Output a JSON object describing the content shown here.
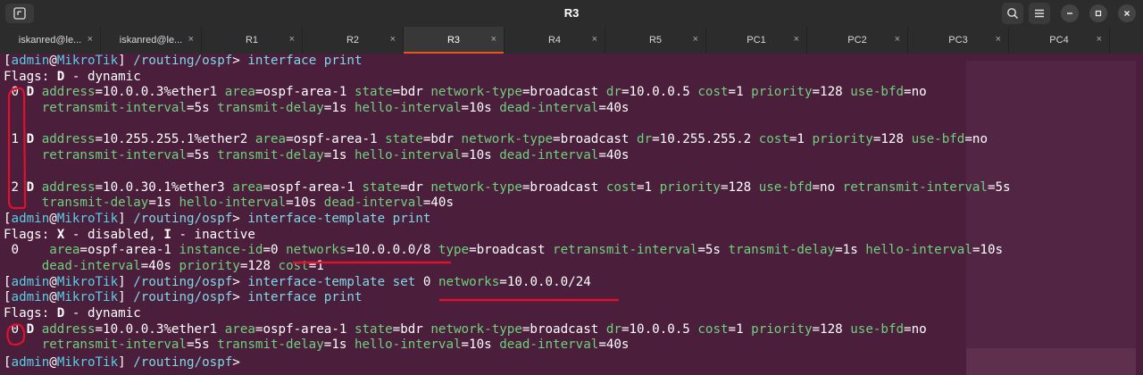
{
  "window": {
    "title": "R3",
    "tabs": [
      {
        "label": "iskanred@le...",
        "active": false
      },
      {
        "label": "iskanred@le...",
        "active": false
      },
      {
        "label": "R1",
        "active": false
      },
      {
        "label": "R2",
        "active": false
      },
      {
        "label": "R3",
        "active": true
      },
      {
        "label": "R4",
        "active": false
      },
      {
        "label": "R5",
        "active": false
      },
      {
        "label": "PC1",
        "active": false
      },
      {
        "label": "PC2",
        "active": false
      },
      {
        "label": "PC3",
        "active": false
      },
      {
        "label": "PC4",
        "active": false
      }
    ],
    "close_glyph": "×"
  },
  "terminal": {
    "prompt_user": "admin",
    "prompt_host": "MikroTik",
    "prompt_path": "/routing/ospf",
    "lines": [
      [
        {
          "c": "w",
          "t": "["
        },
        {
          "c": "pr",
          "t": "admin"
        },
        {
          "c": "w",
          "t": "@"
        },
        {
          "c": "pr",
          "t": "MikroTik"
        },
        {
          "c": "w",
          "t": "] "
        },
        {
          "c": "cmd",
          "t": "/routing/ospf"
        },
        {
          "c": "w",
          "t": "> "
        },
        {
          "c": "cmd",
          "t": "interface print"
        }
      ],
      [
        {
          "c": "w",
          "t": "Flags: "
        },
        {
          "c": "b",
          "t": "D"
        },
        {
          "c": "w",
          "t": " - dynamic"
        }
      ],
      [
        {
          "c": "w",
          "t": " 0 "
        },
        {
          "c": "b",
          "t": "D"
        },
        {
          "c": "w",
          "t": " "
        },
        {
          "c": "key",
          "t": "address"
        },
        {
          "c": "w",
          "t": "=10.0.0.3%ether1 "
        },
        {
          "c": "key",
          "t": "area"
        },
        {
          "c": "w",
          "t": "=ospf-area-1 "
        },
        {
          "c": "key",
          "t": "state"
        },
        {
          "c": "w",
          "t": "=bdr "
        },
        {
          "c": "key",
          "t": "network-type"
        },
        {
          "c": "w",
          "t": "=broadcast "
        },
        {
          "c": "key",
          "t": "dr"
        },
        {
          "c": "w",
          "t": "=10.0.0.5 "
        },
        {
          "c": "key",
          "t": "cost"
        },
        {
          "c": "w",
          "t": "=1 "
        },
        {
          "c": "key",
          "t": "priority"
        },
        {
          "c": "w",
          "t": "=128 "
        },
        {
          "c": "key",
          "t": "use-bfd"
        },
        {
          "c": "w",
          "t": "=no"
        }
      ],
      [
        {
          "c": "w",
          "t": "     "
        },
        {
          "c": "key",
          "t": "retransmit-interval"
        },
        {
          "c": "w",
          "t": "=5s "
        },
        {
          "c": "key",
          "t": "transmit-delay"
        },
        {
          "c": "w",
          "t": "=1s "
        },
        {
          "c": "key",
          "t": "hello-interval"
        },
        {
          "c": "w",
          "t": "=10s "
        },
        {
          "c": "key",
          "t": "dead-interval"
        },
        {
          "c": "w",
          "t": "=40s"
        }
      ],
      [],
      [
        {
          "c": "w",
          "t": " 1 "
        },
        {
          "c": "b",
          "t": "D"
        },
        {
          "c": "w",
          "t": " "
        },
        {
          "c": "key",
          "t": "address"
        },
        {
          "c": "w",
          "t": "=10.255.255.1%ether2 "
        },
        {
          "c": "key",
          "t": "area"
        },
        {
          "c": "w",
          "t": "=ospf-area-1 "
        },
        {
          "c": "key",
          "t": "state"
        },
        {
          "c": "w",
          "t": "=bdr "
        },
        {
          "c": "key",
          "t": "network-type"
        },
        {
          "c": "w",
          "t": "=broadcast "
        },
        {
          "c": "key",
          "t": "dr"
        },
        {
          "c": "w",
          "t": "=10.255.255.2 "
        },
        {
          "c": "key",
          "t": "cost"
        },
        {
          "c": "w",
          "t": "=1 "
        },
        {
          "c": "key",
          "t": "priority"
        },
        {
          "c": "w",
          "t": "=128 "
        },
        {
          "c": "key",
          "t": "use-bfd"
        },
        {
          "c": "w",
          "t": "=no"
        }
      ],
      [
        {
          "c": "w",
          "t": "     "
        },
        {
          "c": "key",
          "t": "retransmit-interval"
        },
        {
          "c": "w",
          "t": "=5s "
        },
        {
          "c": "key",
          "t": "transmit-delay"
        },
        {
          "c": "w",
          "t": "=1s "
        },
        {
          "c": "key",
          "t": "hello-interval"
        },
        {
          "c": "w",
          "t": "=10s "
        },
        {
          "c": "key",
          "t": "dead-interval"
        },
        {
          "c": "w",
          "t": "=40s"
        }
      ],
      [],
      [
        {
          "c": "w",
          "t": " 2 "
        },
        {
          "c": "b",
          "t": "D"
        },
        {
          "c": "w",
          "t": " "
        },
        {
          "c": "key",
          "t": "address"
        },
        {
          "c": "w",
          "t": "=10.0.30.1%ether3 "
        },
        {
          "c": "key",
          "t": "area"
        },
        {
          "c": "w",
          "t": "=ospf-area-1 "
        },
        {
          "c": "key",
          "t": "state"
        },
        {
          "c": "w",
          "t": "=dr "
        },
        {
          "c": "key",
          "t": "network-type"
        },
        {
          "c": "w",
          "t": "=broadcast "
        },
        {
          "c": "key",
          "t": "cost"
        },
        {
          "c": "w",
          "t": "=1 "
        },
        {
          "c": "key",
          "t": "priority"
        },
        {
          "c": "w",
          "t": "=128 "
        },
        {
          "c": "key",
          "t": "use-bfd"
        },
        {
          "c": "w",
          "t": "=no "
        },
        {
          "c": "key",
          "t": "retransmit-interval"
        },
        {
          "c": "w",
          "t": "=5s"
        }
      ],
      [
        {
          "c": "w",
          "t": "     "
        },
        {
          "c": "key",
          "t": "transmit-delay"
        },
        {
          "c": "w",
          "t": "=1s "
        },
        {
          "c": "key",
          "t": "hello-interval"
        },
        {
          "c": "w",
          "t": "=10s "
        },
        {
          "c": "key",
          "t": "dead-interval"
        },
        {
          "c": "w",
          "t": "=40s"
        }
      ],
      [
        {
          "c": "w",
          "t": "["
        },
        {
          "c": "pr",
          "t": "admin"
        },
        {
          "c": "w",
          "t": "@"
        },
        {
          "c": "pr",
          "t": "MikroTik"
        },
        {
          "c": "w",
          "t": "] "
        },
        {
          "c": "cmd",
          "t": "/routing/ospf"
        },
        {
          "c": "w",
          "t": "> "
        },
        {
          "c": "cmd",
          "t": "interface-template print"
        }
      ],
      [
        {
          "c": "w",
          "t": "Flags: "
        },
        {
          "c": "b",
          "t": "X"
        },
        {
          "c": "w",
          "t": " - disabled, "
        },
        {
          "c": "b",
          "t": "I"
        },
        {
          "c": "w",
          "t": " - inactive"
        }
      ],
      [
        {
          "c": "w",
          "t": " 0    "
        },
        {
          "c": "key",
          "t": "area"
        },
        {
          "c": "w",
          "t": "=ospf-area-1 "
        },
        {
          "c": "key",
          "t": "instance-id"
        },
        {
          "c": "w",
          "t": "=0 "
        },
        {
          "c": "key",
          "t": "networks"
        },
        {
          "c": "w",
          "t": "=10.0.0.0/8 "
        },
        {
          "c": "key",
          "t": "type"
        },
        {
          "c": "w",
          "t": "=broadcast "
        },
        {
          "c": "key",
          "t": "retransmit-interval"
        },
        {
          "c": "w",
          "t": "=5s "
        },
        {
          "c": "key",
          "t": "transmit-delay"
        },
        {
          "c": "w",
          "t": "=1s "
        },
        {
          "c": "key",
          "t": "hello-interval"
        },
        {
          "c": "w",
          "t": "=10s"
        }
      ],
      [
        {
          "c": "w",
          "t": "     "
        },
        {
          "c": "key",
          "t": "dead-interval"
        },
        {
          "c": "w",
          "t": "=40s "
        },
        {
          "c": "key",
          "t": "priority"
        },
        {
          "c": "w",
          "t": "=128 "
        },
        {
          "c": "key",
          "t": "cost"
        },
        {
          "c": "w",
          "t": "=1"
        }
      ],
      [
        {
          "c": "w",
          "t": "["
        },
        {
          "c": "pr",
          "t": "admin"
        },
        {
          "c": "w",
          "t": "@"
        },
        {
          "c": "pr",
          "t": "MikroTik"
        },
        {
          "c": "w",
          "t": "] "
        },
        {
          "c": "cmd",
          "t": "/routing/ospf"
        },
        {
          "c": "w",
          "t": "> "
        },
        {
          "c": "cmd",
          "t": "interface-template set"
        },
        {
          "c": "w",
          "t": " 0 "
        },
        {
          "c": "key",
          "t": "networks"
        },
        {
          "c": "w",
          "t": "=10.0.0.0/24"
        }
      ],
      [
        {
          "c": "w",
          "t": "["
        },
        {
          "c": "pr",
          "t": "admin"
        },
        {
          "c": "w",
          "t": "@"
        },
        {
          "c": "pr",
          "t": "MikroTik"
        },
        {
          "c": "w",
          "t": "] "
        },
        {
          "c": "cmd",
          "t": "/routing/ospf"
        },
        {
          "c": "w",
          "t": "> "
        },
        {
          "c": "cmd",
          "t": "interface print"
        }
      ],
      [
        {
          "c": "w",
          "t": "Flags: "
        },
        {
          "c": "b",
          "t": "D"
        },
        {
          "c": "w",
          "t": " - dynamic"
        }
      ],
      [
        {
          "c": "w",
          "t": " 0 "
        },
        {
          "c": "b",
          "t": "D"
        },
        {
          "c": "w",
          "t": " "
        },
        {
          "c": "key",
          "t": "address"
        },
        {
          "c": "w",
          "t": "=10.0.0.3%ether1 "
        },
        {
          "c": "key",
          "t": "area"
        },
        {
          "c": "w",
          "t": "=ospf-area-1 "
        },
        {
          "c": "key",
          "t": "state"
        },
        {
          "c": "w",
          "t": "=bdr "
        },
        {
          "c": "key",
          "t": "network-type"
        },
        {
          "c": "w",
          "t": "=broadcast "
        },
        {
          "c": "key",
          "t": "dr"
        },
        {
          "c": "w",
          "t": "=10.0.0.5 "
        },
        {
          "c": "key",
          "t": "cost"
        },
        {
          "c": "w",
          "t": "=1 "
        },
        {
          "c": "key",
          "t": "priority"
        },
        {
          "c": "w",
          "t": "=128 "
        },
        {
          "c": "key",
          "t": "use-bfd"
        },
        {
          "c": "w",
          "t": "=no"
        }
      ],
      [
        {
          "c": "w",
          "t": "     "
        },
        {
          "c": "key",
          "t": "retransmit-interval"
        },
        {
          "c": "w",
          "t": "=5s "
        },
        {
          "c": "key",
          "t": "transmit-delay"
        },
        {
          "c": "w",
          "t": "=1s "
        },
        {
          "c": "key",
          "t": "hello-interval"
        },
        {
          "c": "w",
          "t": "=10s "
        },
        {
          "c": "key",
          "t": "dead-interval"
        },
        {
          "c": "w",
          "t": "=40s"
        }
      ],
      [
        {
          "c": "w",
          "t": "["
        },
        {
          "c": "pr",
          "t": "admin"
        },
        {
          "c": "w",
          "t": "@"
        },
        {
          "c": "pr",
          "t": "MikroTik"
        },
        {
          "c": "w",
          "t": "] "
        },
        {
          "c": "cmd",
          "t": "/routing/ospf"
        },
        {
          "c": "w",
          "t": "> "
        }
      ]
    ]
  },
  "colors": {
    "background": "#4b1e3c",
    "titlebar": "#2c2c2c",
    "active_tab_accent": "#e95420",
    "prompt": "#55d0e6",
    "keyword": "#6fd17d",
    "annotation": "#e0112e"
  },
  "icons": {
    "new_tab": "terminal-new-tab-icon",
    "search": "search-icon",
    "menu": "hamburger-menu-icon",
    "minimize": "minimize-icon",
    "restore": "restore-icon",
    "close": "close-icon"
  }
}
